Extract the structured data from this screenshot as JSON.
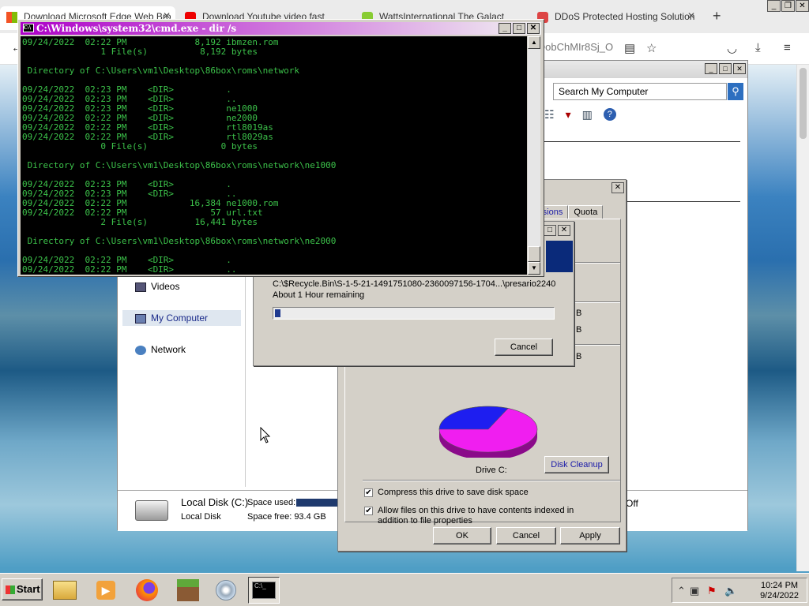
{
  "browser": {
    "tabs": [
      {
        "label": "Download Microsoft Edge Web Bro"
      },
      {
        "label": "Download Youtube video fast"
      },
      {
        "label": "WattsInternational The Galact"
      },
      {
        "label": "DDoS Protected Hosting Solution"
      }
    ],
    "url_fragment": "QobChMIr8Sj_O"
  },
  "explorer": {
    "search_placeholder": "Search My Computer",
    "nav": [
      {
        "label": "Videos"
      },
      {
        "label": "My Computer"
      },
      {
        "label": "Network"
      }
    ],
    "details": {
      "name": "Local Disk (C:)",
      "type": "Local Disk",
      "used_label": "Space used:",
      "free_label": "Space free: 93.4 GB",
      "tail": "Off"
    }
  },
  "properties": {
    "tabs": [
      "rsions",
      "Quota"
    ],
    "b_values": [
      "B",
      "B",
      "B"
    ],
    "drive_label": "Drive C:",
    "disk_cleanup": "Disk Cleanup",
    "compress_label": "Compress this drive to save disk space",
    "index_label": "Allow files on this drive to have contents indexed in addition to file properties",
    "ok": "OK",
    "cancel": "Cancel",
    "apply": "Apply"
  },
  "copy_dialog": {
    "path": "C:\\$Recycle.Bin\\S-1-5-21-1491751080-2360097156-1704...\\presario2240",
    "remaining": "About 1 Hour remaining",
    "progress": 0.02,
    "cancel": "Cancel"
  },
  "cmd": {
    "title": "C:\\Windows\\system32\\cmd.exe - dir  /s",
    "lines": [
      "09/24/2022  02:22 PM             8,192 ibmzen.rom",
      "               1 File(s)          8,192 bytes",
      "",
      " Directory of C:\\Users\\vm1\\Desktop\\86box\\roms\\network",
      "",
      "09/24/2022  02:23 PM    <DIR>          .",
      "09/24/2022  02:23 PM    <DIR>          ..",
      "09/24/2022  02:23 PM    <DIR>          ne1000",
      "09/24/2022  02:22 PM    <DIR>          ne2000",
      "09/24/2022  02:22 PM    <DIR>          rtl8019as",
      "09/24/2022  02:22 PM    <DIR>          rtl8029as",
      "               0 File(s)              0 bytes",
      "",
      " Directory of C:\\Users\\vm1\\Desktop\\86box\\roms\\network\\ne1000",
      "",
      "09/24/2022  02:23 PM    <DIR>          .",
      "09/24/2022  02:23 PM    <DIR>          ..",
      "09/24/2022  02:22 PM            16,384 ne1000.rom",
      "09/24/2022  02:22 PM                57 url.txt",
      "               2 File(s)         16,441 bytes",
      "",
      " Directory of C:\\Users\\vm1\\Desktop\\86box\\roms\\network\\ne2000",
      "",
      "09/24/2022  02:22 PM    <DIR>          .",
      "09/24/2022  02:22 PM    <DIR>          .."
    ]
  },
  "taskbar": {
    "start": "Start",
    "time": "10:24 PM",
    "date": "9/24/2022"
  },
  "colors": {
    "cmd_text": "#3cc24a",
    "cmd_title_start": "#ad00c8",
    "pie_used": "#1e1ef0",
    "pie_free": "#f01ef0"
  }
}
